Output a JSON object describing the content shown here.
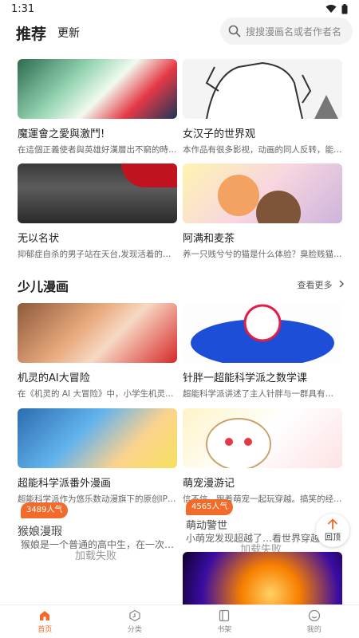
{
  "status": {
    "time": "1:31"
  },
  "header": {
    "tab_recommend": "推荐",
    "tab_update": "更新",
    "search_placeholder": "搜搜漫画名或者作者名"
  },
  "recommend": [
    {
      "title": "魔運會之愛與激鬥!",
      "desc": "在這個正義使者與英雄好漢層出不窮的時…"
    },
    {
      "title": "女汉子的世界观",
      "desc": "本作品有很多影视，动画的同人反转，能 …"
    },
    {
      "title": "无以名状",
      "desc": "抑郁症自杀的男子站在天台,发现活着的自…"
    },
    {
      "title": "阿满和麦茶",
      "desc": "养一只贱兮兮的猫是什么体验？臭脸贱猫…"
    }
  ],
  "kids_section": {
    "title": "少儿漫画",
    "more": "查看更多"
  },
  "kids": [
    {
      "title": "机灵的AI大冒险",
      "desc": "在《机灵的 AI 大冒险》中，小学生机灵姐…"
    },
    {
      "title": "针胖一超能科学派之数学课",
      "desc": "超能科学派讲述了主人针胖与一群具有…"
    },
    {
      "title": "超能科学派番外漫画",
      "desc": "超能科学派作为悠乐数动漫旗下的原创IP形…"
    },
    {
      "title": "萌宠漫游记",
      "desc": "信不信，跟着萌宠一起玩穿越。搞笑的经…"
    }
  ],
  "popular": [
    {
      "badge": "3489人气",
      "overlap_title": "猴娘漫瑕",
      "overlap_desc": "猴娘是一个普通的高中生，在一次…",
      "fail": "加载失败"
    },
    {
      "badge": "4565人气",
      "overlap_title": "萌动警世",
      "overlap_desc": "小萌宠发现超越了…看世界穿越…",
      "fail": "加载失败"
    }
  ],
  "back_top": "回顶",
  "nav": [
    {
      "label": "首页",
      "icon": "home-icon",
      "active": true
    },
    {
      "label": "分类",
      "icon": "category-icon",
      "active": false
    },
    {
      "label": "书架",
      "icon": "bookshelf-icon",
      "active": false
    },
    {
      "label": "我的",
      "icon": "profile-icon",
      "active": false
    }
  ],
  "colors": {
    "accent": "#f26b2a"
  }
}
